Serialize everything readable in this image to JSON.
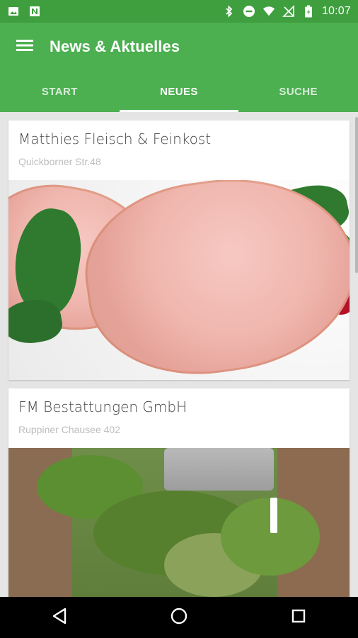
{
  "status_bar": {
    "time": "10:07",
    "left_icons": [
      "image-icon",
      "n-icon"
    ],
    "right_icons": [
      "bluetooth-icon",
      "do-not-disturb-icon",
      "wifi-icon",
      "no-signal-icon",
      "battery-icon"
    ]
  },
  "app_bar": {
    "title": "News & Aktuelles",
    "menu_icon": "hamburger-menu-icon",
    "color": "#4caf50"
  },
  "tabs": [
    {
      "label": "START",
      "active": false
    },
    {
      "label": "NEUES",
      "active": true
    },
    {
      "label": "SUCHE",
      "active": false
    }
  ],
  "cards": [
    {
      "name": "Matthies Fleisch & Feinkost",
      "address": "Quickborner Str.48",
      "image": "meat-image"
    },
    {
      "name": "FM Bestattungen GmbH",
      "address": "Ruppiner Chausee 402",
      "image": "grave-image"
    }
  ],
  "nav_bar": {
    "icons": [
      "back-icon",
      "home-icon",
      "recents-icon"
    ]
  }
}
